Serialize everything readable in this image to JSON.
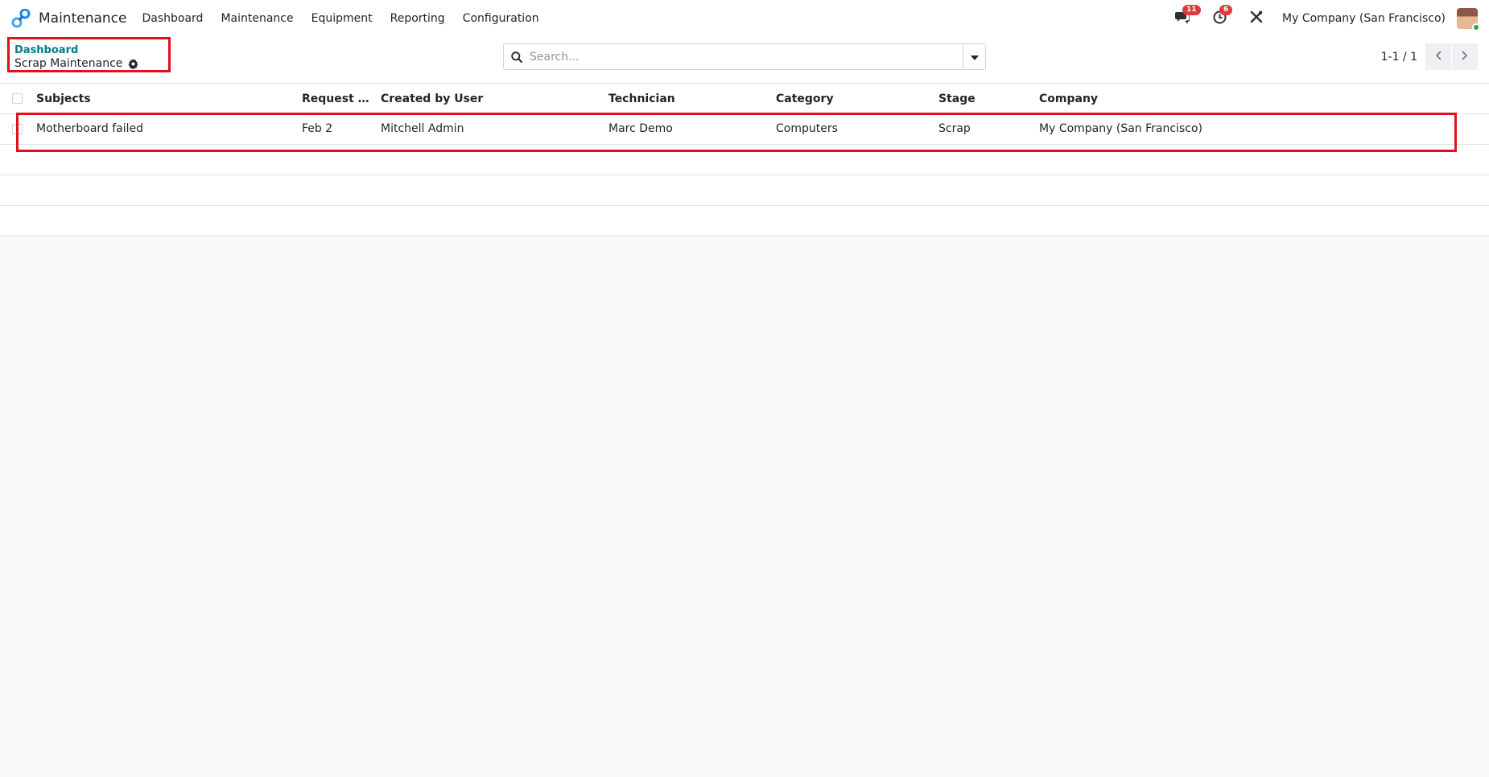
{
  "app": {
    "name": "Maintenance"
  },
  "menu": [
    {
      "label": "Dashboard"
    },
    {
      "label": "Maintenance"
    },
    {
      "label": "Equipment"
    },
    {
      "label": "Reporting"
    },
    {
      "label": "Configuration"
    }
  ],
  "systray": {
    "messages_count": "11",
    "activities_count": "6",
    "company": "My Company (San Francisco)"
  },
  "breadcrumb": {
    "parent": "Dashboard",
    "current": "Scrap Maintenance"
  },
  "search": {
    "value": "",
    "placeholder": "Search..."
  },
  "pager": {
    "value": "1-1 / 1"
  },
  "table": {
    "columns": [
      "Subjects",
      "Request D...",
      "Created by User",
      "Technician",
      "Category",
      "Stage",
      "Company"
    ],
    "rows": [
      {
        "subject": "Motherboard failed",
        "request_date": "Feb 2",
        "created_by": "Mitchell Admin",
        "technician": "Marc Demo",
        "category": "Computers",
        "stage": "Scrap",
        "company": "My Company (San Francisco)"
      }
    ]
  },
  "colors": {
    "accent": "#017e84",
    "highlight": "#e1101b",
    "badge": "#e03b3b"
  }
}
